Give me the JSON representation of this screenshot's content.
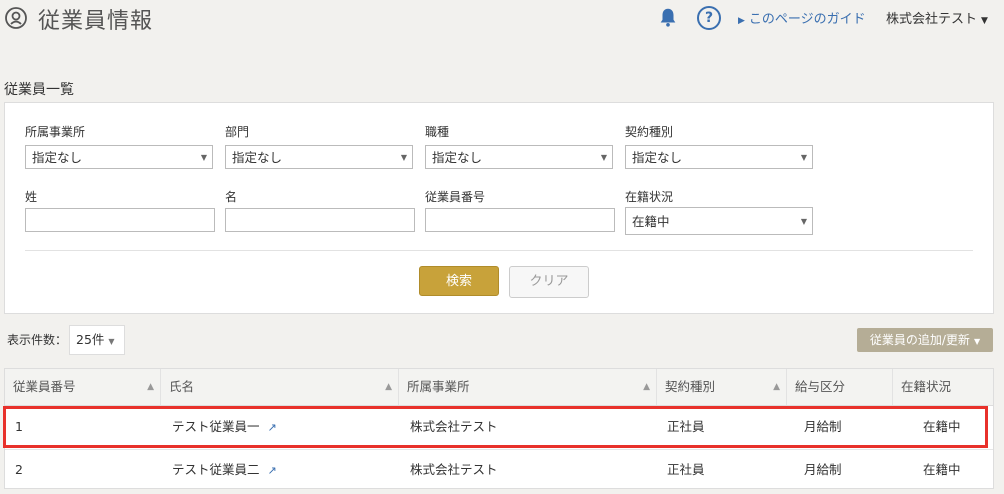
{
  "header": {
    "title": "従業員情報",
    "guide_label": "このページのガイド",
    "company_label": "株式会社テスト",
    "help_label": "?"
  },
  "section_title": "従業員一覧",
  "filters": {
    "office": {
      "label": "所属事業所",
      "value": "指定なし"
    },
    "department": {
      "label": "部門",
      "value": "指定なし"
    },
    "job_type": {
      "label": "職種",
      "value": "指定なし"
    },
    "contract_type": {
      "label": "契約種別",
      "value": "指定なし"
    },
    "last_name": {
      "label": "姓",
      "value": ""
    },
    "first_name": {
      "label": "名",
      "value": ""
    },
    "employee_number": {
      "label": "従業員番号",
      "value": ""
    },
    "employment_status": {
      "label": "在籍状況",
      "value": "在籍中"
    }
  },
  "buttons": {
    "search": "検索",
    "clear": "クリア",
    "add_update": "従業員の追加/更新"
  },
  "display_count": {
    "label": "表示件数：",
    "value": "25件"
  },
  "table": {
    "columns": [
      "従業員番号",
      "氏名",
      "所属事業所",
      "契約種別",
      "給与区分",
      "在籍状況"
    ],
    "rows": [
      {
        "number": "1",
        "name": "テスト従業員一",
        "office": "株式会社テスト",
        "contract": "正社員",
        "pay_type": "月給制",
        "status": "在籍中"
      },
      {
        "number": "2",
        "name": "テスト従業員二",
        "office": "株式会社テスト",
        "contract": "正社員",
        "pay_type": "月給制",
        "status": "在籍中"
      }
    ]
  },
  "colors": {
    "accent_gold": "#c8a23a",
    "link_blue": "#3a6fb0",
    "highlight_red": "#e8312b"
  }
}
